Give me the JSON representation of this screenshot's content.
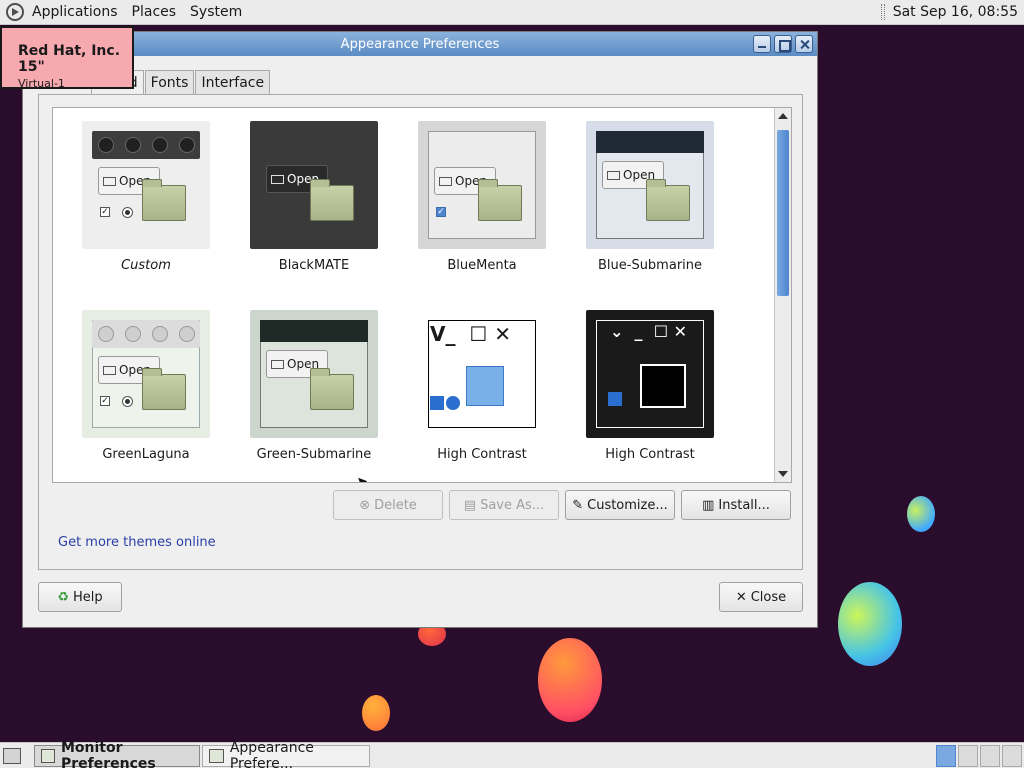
{
  "top_panel": {
    "menus": [
      "Applications",
      "Places",
      "System"
    ],
    "clock": "Sat Sep 16, 08:55"
  },
  "osd": {
    "title": "Red Hat, Inc. 15\"",
    "subtitle": "Virtual-1"
  },
  "window": {
    "title": "Appearance Preferences",
    "tabs": [
      {
        "label": "round",
        "active": true
      },
      {
        "label": "Fonts"
      },
      {
        "label": "Interface"
      }
    ],
    "themes": [
      {
        "name": "Custom"
      },
      {
        "name": "BlackMATE"
      },
      {
        "name": "BlueMenta"
      },
      {
        "name": "Blue-Submarine"
      },
      {
        "name": "GreenLaguna"
      },
      {
        "name": "Green-Submarine"
      },
      {
        "name": "High Contrast"
      },
      {
        "name": "High Contrast"
      }
    ],
    "thumb_open_label": "Open",
    "buttons": {
      "delete": "Delete",
      "save_as": "Save As...",
      "customize": "Customize...",
      "install": "Install..."
    },
    "link": "Get more themes online",
    "help": "Help",
    "close": "Close"
  },
  "taskbar": {
    "tasks": [
      {
        "label": "Monitor Preferences",
        "active": true
      },
      {
        "label": "Appearance Prefere..."
      }
    ]
  },
  "colors": {
    "desktop": "#2a0c2c",
    "titlebar": "#5a8bc4",
    "osd": "#f7a9b0",
    "link": "#2a3fa8"
  }
}
